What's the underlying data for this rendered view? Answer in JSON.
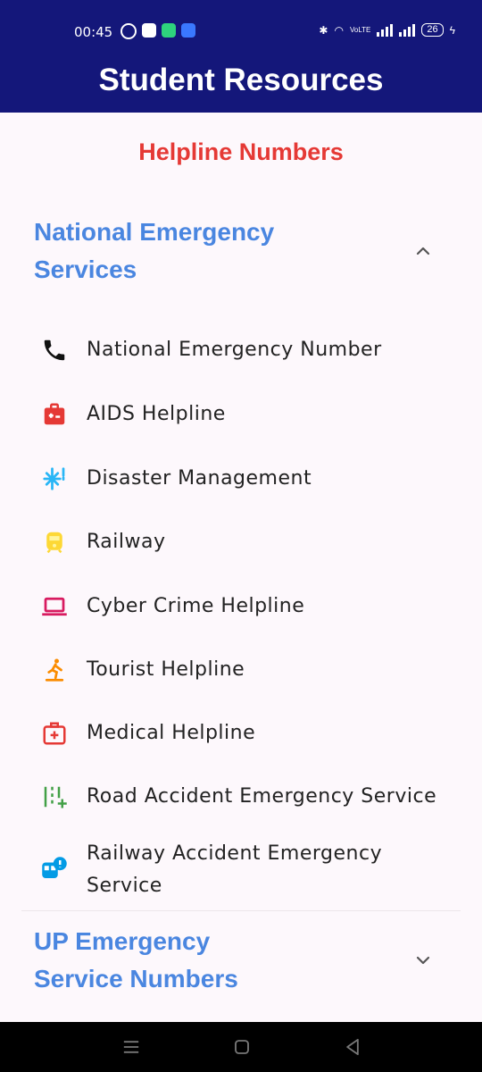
{
  "status_bar": {
    "time": "00:45",
    "battery": "26",
    "network": "VoLTE"
  },
  "app_bar": {
    "title": "Student Resources"
  },
  "section": {
    "title": "Helpline Numbers"
  },
  "groups": [
    {
      "title": "National Emergency Services",
      "expanded": true,
      "items": [
        {
          "label": "National Emergency Number",
          "icon": "phone-icon",
          "color": "#111111"
        },
        {
          "label": "AIDS Helpline",
          "icon": "medical-kit-icon",
          "color": "#e53935"
        },
        {
          "label": "Disaster Management",
          "icon": "snowflake-alert-icon",
          "color": "#29b6f6"
        },
        {
          "label": "Railway",
          "icon": "train-icon",
          "color": "#fdd835"
        },
        {
          "label": "Cyber Crime Helpline",
          "icon": "laptop-icon",
          "color": "#d81b60"
        },
        {
          "label": "Tourist Helpline",
          "icon": "hiker-icon",
          "color": "#fb8c00"
        },
        {
          "label": "Medical Helpline",
          "icon": "first-aid-icon",
          "color": "#e53935"
        },
        {
          "label": "Road Accident Emergency Service",
          "icon": "road-plus-icon",
          "color": "#43a047"
        },
        {
          "label": "Railway Accident Emergency Service",
          "icon": "train-alert-icon",
          "color": "#039be5"
        }
      ]
    },
    {
      "title": "UP Emergency Service Numbers",
      "expanded": false,
      "items": []
    }
  ],
  "nav_bar": {
    "buttons": [
      "menu-icon",
      "home-icon",
      "back-icon"
    ]
  }
}
